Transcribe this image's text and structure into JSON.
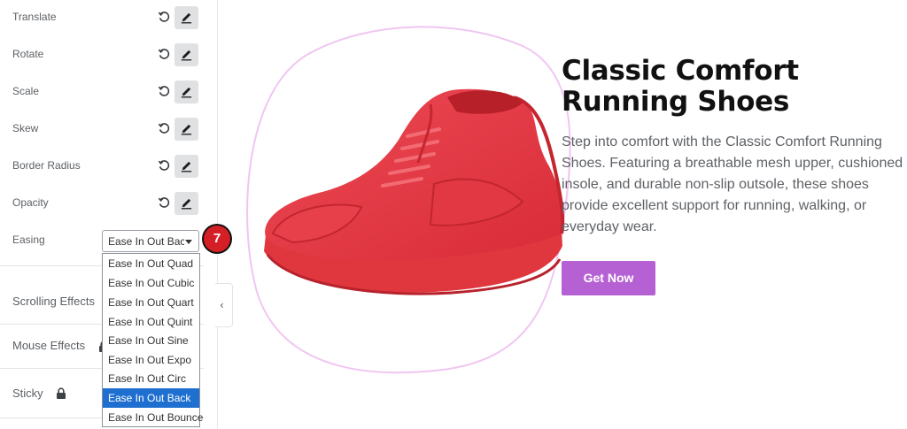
{
  "panel": {
    "transform_rows": [
      {
        "label": "Translate",
        "reset_icon": "reset-icon",
        "edit_icon": "pencil-icon"
      },
      {
        "label": "Rotate",
        "reset_icon": "reset-icon",
        "edit_icon": "pencil-icon"
      },
      {
        "label": "Scale",
        "reset_icon": "reset-icon",
        "edit_icon": "pencil-icon"
      },
      {
        "label": "Skew",
        "reset_icon": "reset-icon",
        "edit_icon": "pencil-icon"
      },
      {
        "label": "Border Radius",
        "reset_icon": "reset-icon",
        "edit_icon": "pencil-icon"
      },
      {
        "label": "Opacity",
        "reset_icon": "reset-icon",
        "edit_icon": "pencil-icon"
      }
    ],
    "easing": {
      "label": "Easing",
      "selected": "Ease In Out Back",
      "options": [
        "Ease In Out Quad",
        "Ease In Out Cubic",
        "Ease In Out Quart",
        "Ease In Out Quint",
        "Ease In Out Sine",
        "Ease In Out Expo",
        "Ease In Out Circ",
        "Ease In Out Back",
        "Ease In Out Bounce"
      ],
      "highlighted_option": "Ease In Out Back"
    },
    "step_badge": "7",
    "sections": [
      {
        "label": "Scrolling Effects",
        "locked": false
      },
      {
        "label": "Mouse Effects",
        "locked": true
      },
      {
        "label": "Sticky",
        "locked": true
      }
    ],
    "collapse_icon": "chevron-left-icon",
    "collapse_glyph": "‹"
  },
  "preview": {
    "title": "Classic Comfort Running Shoes",
    "description": "Step into comfort with the Classic Comfort Running Shoes. Featuring a breathable mesh upper, cushioned insole, and durable non-slip outsole, these shoes provide excellent support for running, walking, or everyday wear.",
    "button_label": "Get Now",
    "image": "red-running-shoe"
  },
  "colors": {
    "accent": "#b661d3",
    "badge": "#d41f26",
    "selected_option": "#1f6fd0",
    "blob_outline": "#f0c6f2",
    "shoe": "#e53a45"
  }
}
